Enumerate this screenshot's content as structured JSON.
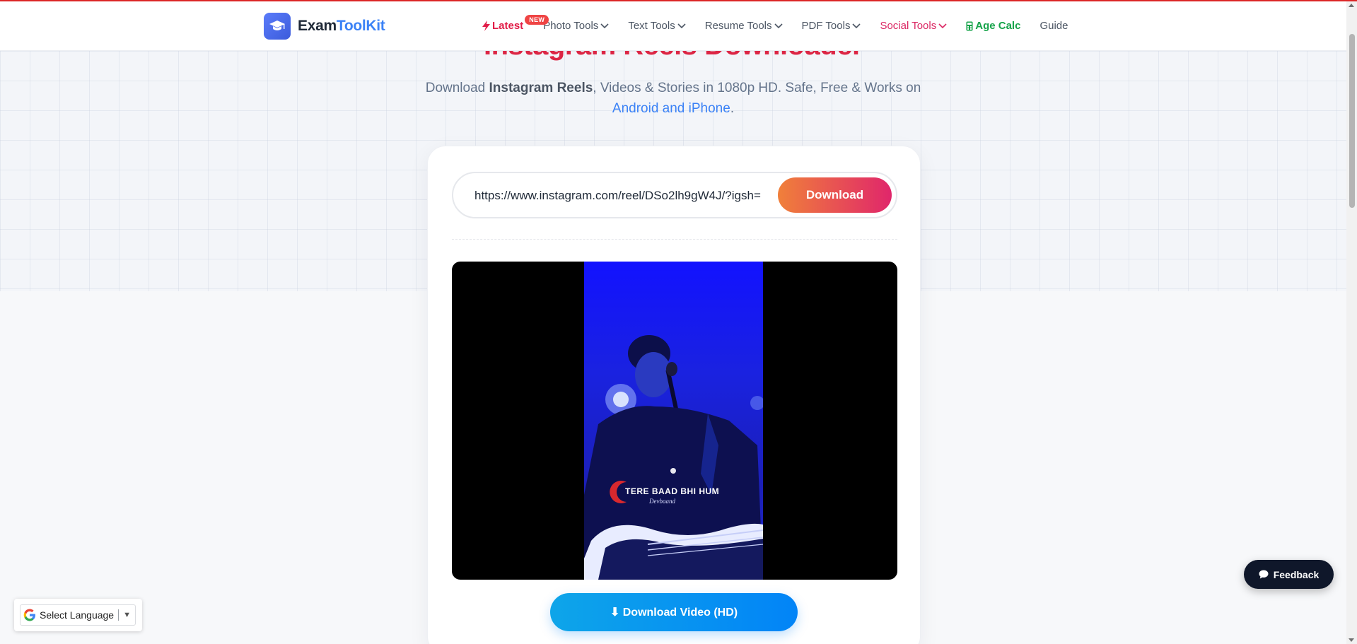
{
  "brand": {
    "name_part1": "Exam",
    "name_part2": "ToolKit",
    "icon": "graduation-cap-icon",
    "accent_color": "#3b82f6"
  },
  "nav": {
    "latest": "Latest",
    "latest_badge": "NEW",
    "photo_tools": "Photo Tools",
    "text_tools": "Text Tools",
    "resume_tools": "Resume Tools",
    "pdf_tools": "PDF Tools",
    "social_tools": "Social Tools",
    "age_calc": "Age Calc",
    "guide": "Guide"
  },
  "hero": {
    "title": "Instagram Reels Downloader",
    "sub_prefix": "Download ",
    "sub_bold": "Instagram Reels",
    "sub_mid": ", Videos & Stories in 1080p HD. Safe, Free & Works on",
    "sub_link": "Android and iPhone",
    "sub_end": ".",
    "title_color": "#dc2645"
  },
  "downloader": {
    "url_value": "https://www.instagram.com/reel/DSo2lh9gW4J/?igsh=",
    "download_label": "Download",
    "video_overlay_title": "TERE BAAD BHI HUM",
    "video_overlay_sub": "Devbaand",
    "download_video_label": "⬇ Download Video (HD)"
  },
  "language": {
    "label": "Select Language",
    "caret": "▼"
  },
  "feedback": {
    "label": "Feedback"
  }
}
